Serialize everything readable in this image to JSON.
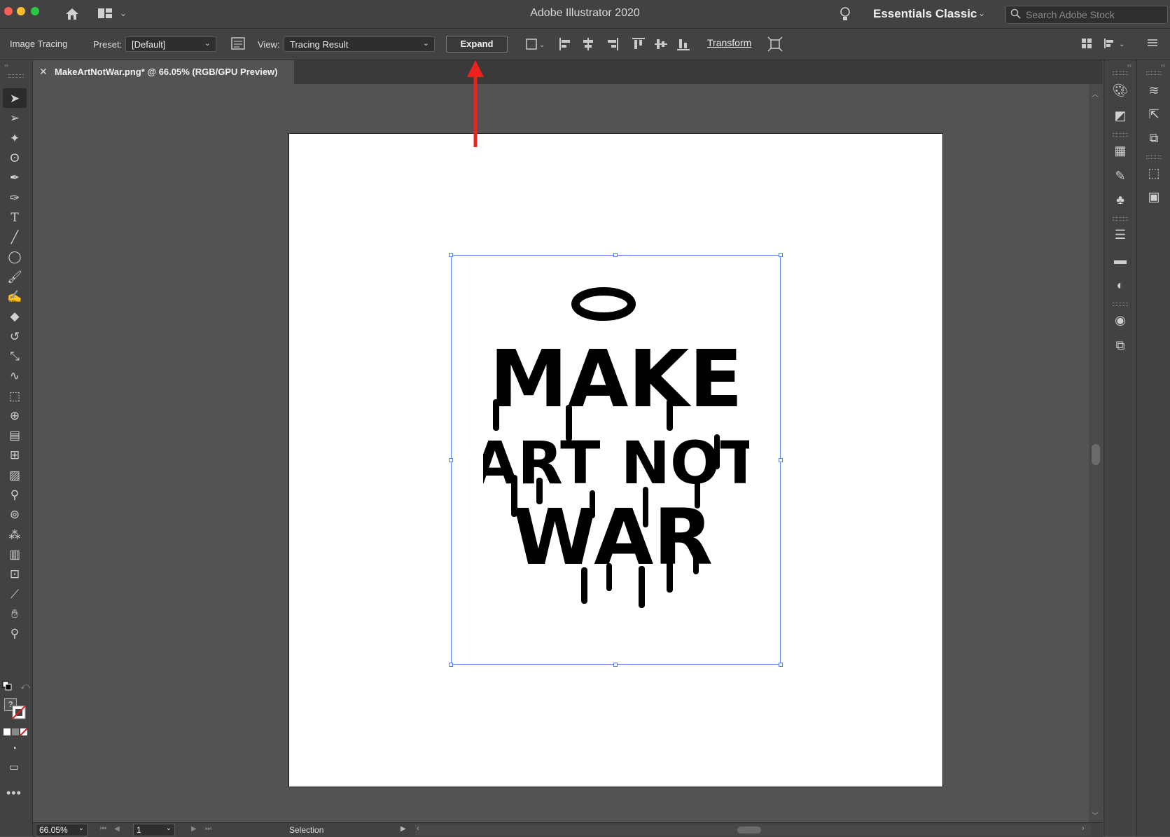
{
  "window": {
    "title": "Adobe Illustrator 2020",
    "workspace": "Essentials Classic",
    "search_placeholder": "Search Adobe Stock",
    "traffic_colors": [
      "#fe5f57",
      "#febc2e",
      "#28c840"
    ]
  },
  "control_bar": {
    "mode_label": "Image Tracing",
    "preset_label": "Preset:",
    "preset_value": "[Default]",
    "view_label": "View:",
    "view_value": "Tracing Result",
    "expand_label": "Expand",
    "transform_label": "Transform"
  },
  "document": {
    "tab_title": "MakeArtNotWar.png* @ 66.05% (RGB/GPU Preview)",
    "artwork_lines": [
      "MAKE",
      "ART NOT",
      "WAR"
    ]
  },
  "annotation": {
    "color": "#e8241c",
    "target": "expand-button"
  },
  "status_bar": {
    "zoom": "66.05%",
    "artboard_number": "1",
    "tool_name": "Selection"
  },
  "toolbar": {
    "tools": [
      "selection-tool-icon",
      "direct-selection-tool-icon",
      "magic-wand-icon",
      "lasso-icon",
      "pen-icon",
      "curvature-icon",
      "type-icon",
      "line-icon",
      "ellipse-icon",
      "paintbrush-icon",
      "blob-brush-icon",
      "eraser-icon",
      "rotate-icon",
      "scale-icon",
      "warp-icon",
      "free-transform-icon",
      "shape-builder-icon",
      "perspective-grid-icon",
      "mesh-icon",
      "gradient-icon",
      "eyedropper-icon",
      "blend-icon",
      "symbol-sprayer-icon",
      "graph-icon",
      "artboard-icon",
      "slice-icon",
      "hand-icon",
      "zoom-icon"
    ]
  }
}
